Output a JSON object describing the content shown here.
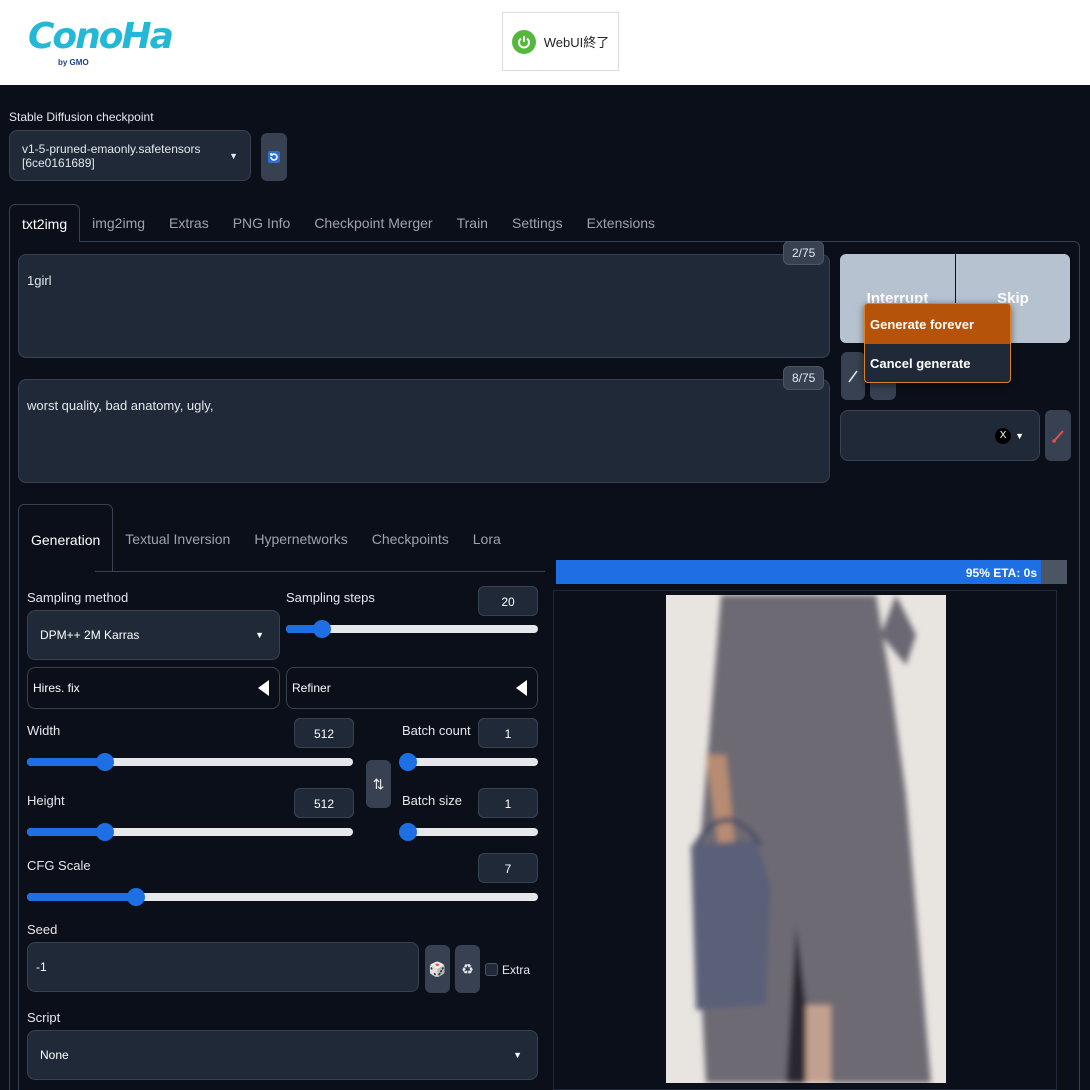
{
  "header": {
    "logo_text": "ConoHa",
    "logo_sub": "by GMO",
    "end_button": "WebUI終了"
  },
  "checkpoint": {
    "label": "Stable Diffusion checkpoint",
    "value": "v1-5-pruned-emaonly.safetensors [6ce0161689]"
  },
  "tabs": [
    "txt2img",
    "img2img",
    "Extras",
    "PNG Info",
    "Checkpoint Merger",
    "Train",
    "Settings",
    "Extensions"
  ],
  "prompt": {
    "text": "1girl",
    "counter": "2/75"
  },
  "negative_prompt": {
    "text": "worst quality, bad anatomy, ugly,",
    "counter": "8/75"
  },
  "actions": {
    "interrupt": "Interrupt",
    "skip": "Skip"
  },
  "context_menu": [
    "Generate forever",
    "Cancel generate forever"
  ],
  "styles": {
    "clear": "X"
  },
  "subtabs": [
    "Generation",
    "Textual Inversion",
    "Hypernetworks",
    "Checkpoints",
    "Lora"
  ],
  "generation": {
    "sampling_method_label": "Sampling method",
    "sampling_method": "DPM++ 2M Karras",
    "sampling_steps_label": "Sampling steps",
    "sampling_steps": "20",
    "hires_fix": "Hires. fix",
    "refiner": "Refiner",
    "width_label": "Width",
    "width": "512",
    "height_label": "Height",
    "height": "512",
    "batch_count_label": "Batch count",
    "batch_count": "1",
    "batch_size_label": "Batch size",
    "batch_size": "1",
    "cfg_label": "CFG Scale",
    "cfg": "7",
    "seed_label": "Seed",
    "seed": "-1",
    "extra_label": "Extra",
    "script_label": "Script",
    "script": "None"
  },
  "progress": {
    "text": "95% ETA: 0s",
    "fraction": 0.95
  },
  "colors": {
    "accent": "#1d6fe3",
    "background": "#0b0f19",
    "panel": "#1f2937",
    "menu_highlight": "#b45309"
  }
}
